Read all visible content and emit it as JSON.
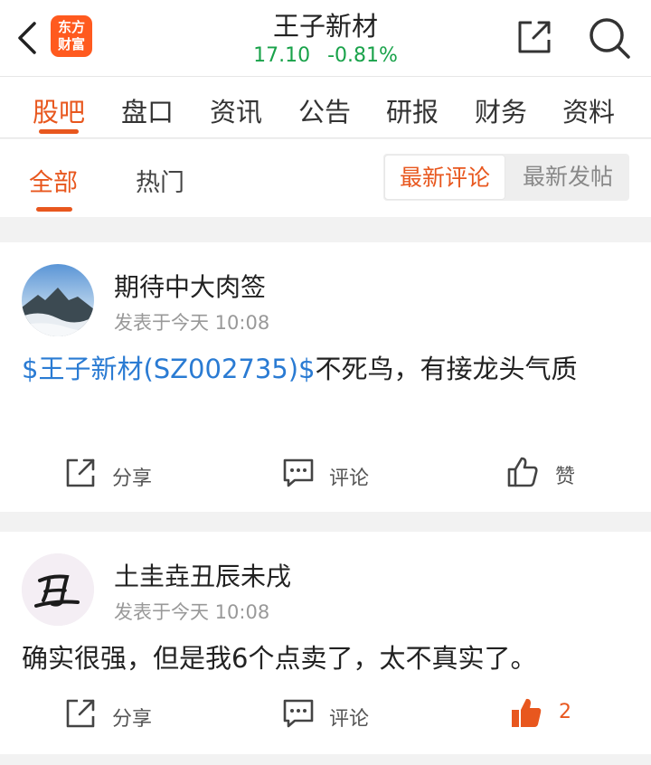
{
  "header": {
    "logo_line1": "东方",
    "logo_line2": "财富",
    "stock_name": "王子新材",
    "price": "17.10",
    "change": "-0.81%"
  },
  "main_tabs": [
    "股吧",
    "盘口",
    "资讯",
    "公告",
    "研报",
    "财务",
    "资料"
  ],
  "sub_tabs": {
    "all": "全部",
    "hot": "热门",
    "sort_latest_comment": "最新评论",
    "sort_latest_post": "最新发帖"
  },
  "posts": [
    {
      "author": "期待中大肉签",
      "meta": "发表于今天 10:08",
      "stock_tag": "$王子新材(SZ002735)$",
      "text": "不死鸟，有接龙头气质",
      "share": "分享",
      "comment": "评论",
      "like": "赞"
    },
    {
      "author": "土圭垚丑辰未戌",
      "meta": "发表于今天 10:08",
      "text": "确实很强，但是我6个点卖了，太不真实了。",
      "share": "分享",
      "comment": "评论",
      "like": "2"
    }
  ],
  "colors": {
    "accent": "#e8571e",
    "price_down": "#19a24a",
    "stock_link": "#2a7bd3",
    "liked": "#e8571e"
  }
}
